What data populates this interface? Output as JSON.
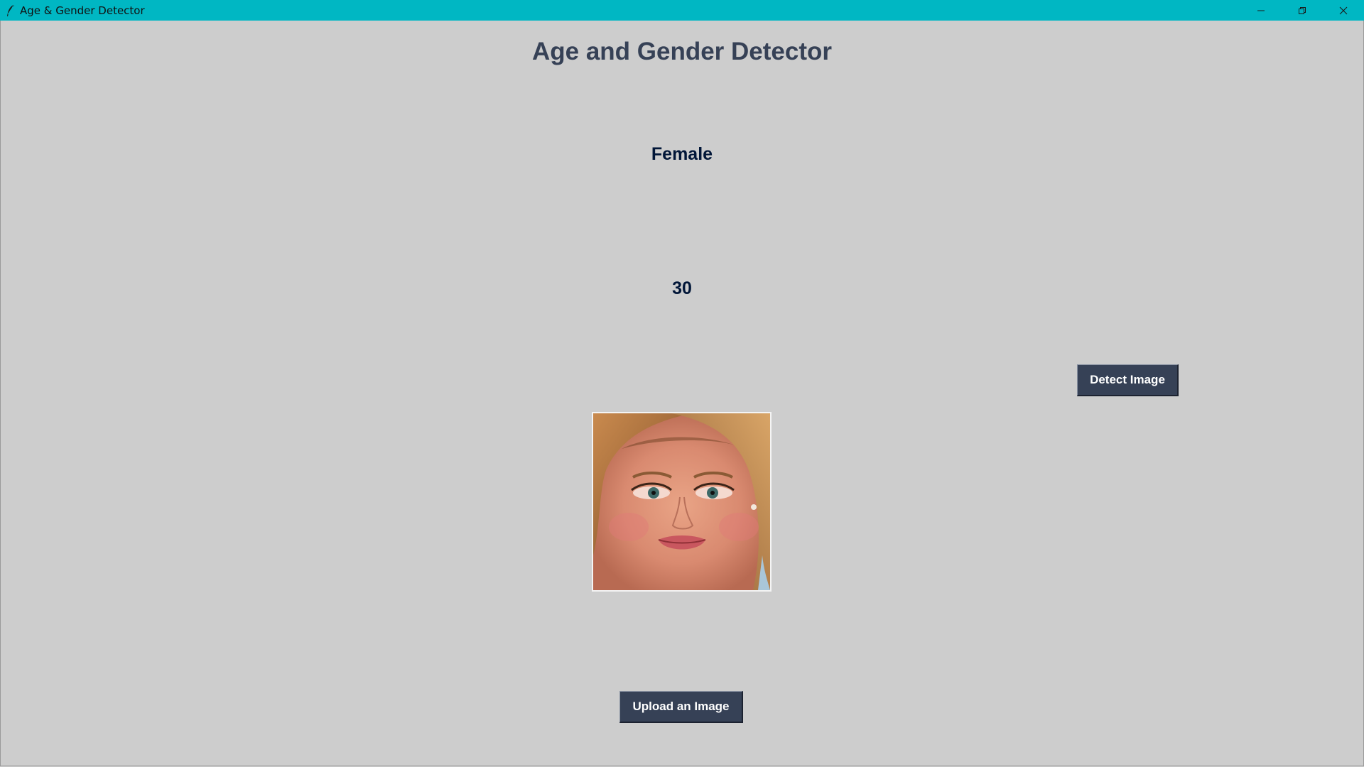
{
  "window": {
    "title": "Age & Gender Detector",
    "titlebar_color": "#00b7c3"
  },
  "colors": {
    "background": "#cdcdcd",
    "heading": "#364156",
    "result_text": "#011638",
    "button_bg": "#364156",
    "button_text": "#ffffff"
  },
  "main": {
    "heading": "Age and Gender Detector",
    "gender_label": "Female",
    "age_label": "30",
    "detect_button_label": "Detect Image",
    "upload_button_label": "Upload an Image",
    "image": {
      "description_icon": "face-photo"
    }
  }
}
